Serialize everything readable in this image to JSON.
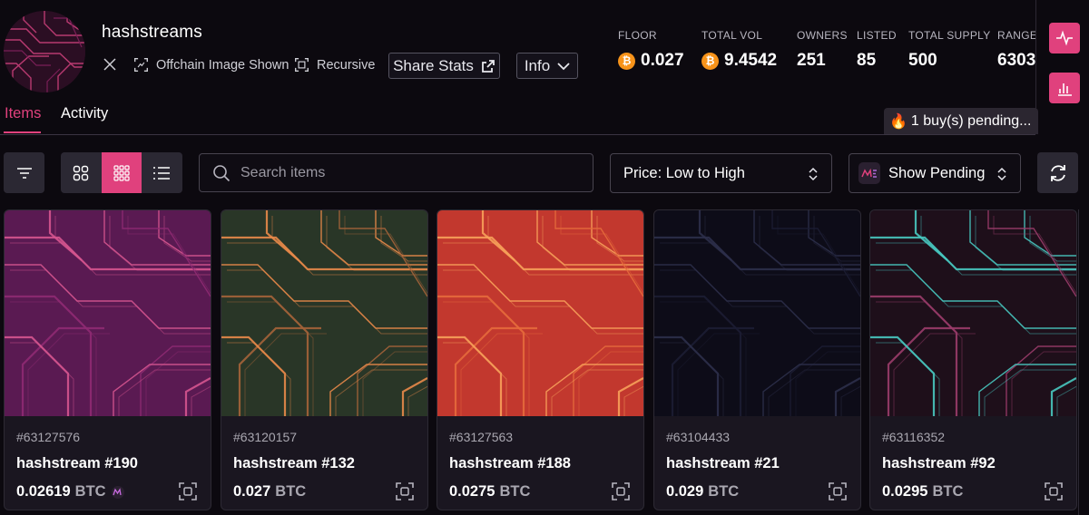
{
  "collection": {
    "name": "hashstreams",
    "tags": {
      "offchain": "Offchain Image Shown",
      "recursive": "Recursive"
    },
    "share_label": "Share Stats",
    "info_label": "Info"
  },
  "stats": [
    {
      "label": "FLOOR",
      "value": "0.027",
      "btc": true
    },
    {
      "label": "TOTAL VOL",
      "value": "9.4542",
      "btc": true
    },
    {
      "label": "OWNERS",
      "value": "251",
      "btc": false
    },
    {
      "label": "LISTED",
      "value": "85",
      "btc": false
    },
    {
      "label": "TOTAL SUPPLY",
      "value": "500",
      "btc": false
    },
    {
      "label": "RANGE",
      "value": "6303",
      "btc": false
    }
  ],
  "tabs": [
    {
      "label": "Items",
      "active": true
    },
    {
      "label": "Activity",
      "active": false
    }
  ],
  "pending": "1 buy(s) pending...",
  "search": {
    "placeholder": "Search items"
  },
  "sort": {
    "value": "Price: Low to High"
  },
  "pending_filter": {
    "value": "Show Pending"
  },
  "currency": "BTC",
  "items": [
    {
      "inscription": "#63127576",
      "title": "hashstream #190",
      "price": "0.02619",
      "pending": true,
      "bg": "#5a1a52",
      "line": "#d5558f",
      "line2": "#8e2a72"
    },
    {
      "inscription": "#63120157",
      "title": "hashstream #132",
      "price": "0.027",
      "pending": false,
      "bg": "#293627",
      "line": "#e8894a",
      "line2": "#a4633a"
    },
    {
      "inscription": "#63127563",
      "title": "hashstream #188",
      "price": "0.0275",
      "pending": false,
      "bg": "#c2382e",
      "line": "#f7a15a",
      "line2": "#e56a3c"
    },
    {
      "inscription": "#63104433",
      "title": "hashstream #21",
      "price": "0.029",
      "pending": false,
      "bg": "#0d0c18",
      "line": "#2c2f4a",
      "line2": "#1c1d33"
    },
    {
      "inscription": "#63116352",
      "title": "hashstream #92",
      "price": "0.0295",
      "pending": false,
      "bg": "#1e0f1a",
      "line": "#48c8c0",
      "line2": "#9a3c6a"
    }
  ],
  "colors": {
    "accent": "#e0417d",
    "btc": "#f7931a"
  }
}
